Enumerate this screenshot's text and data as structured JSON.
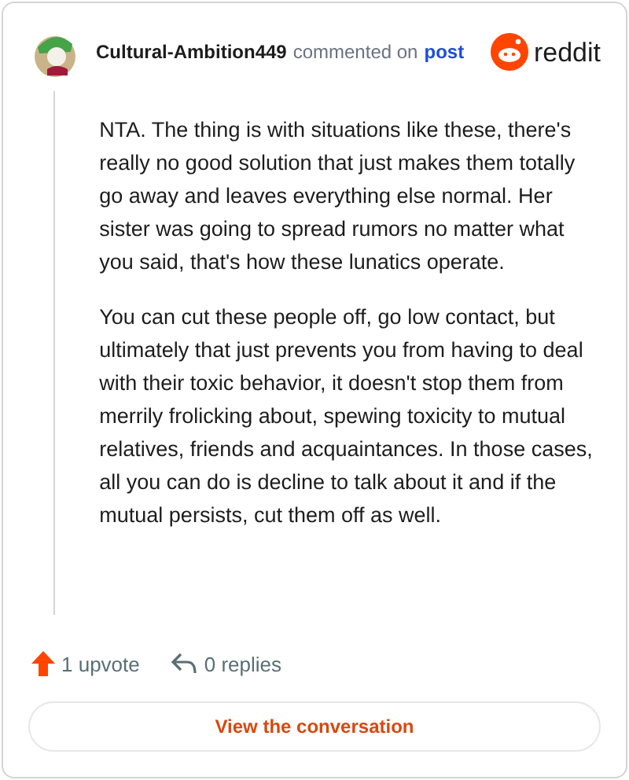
{
  "header": {
    "username": "Cultural-Ambition449",
    "action": "commented on",
    "link": "post",
    "brand": "reddit"
  },
  "comment": {
    "paragraphs": [
      "NTA. The thing is with situations like these, there's really no good solution that just makes them totally go away and leaves everything else normal. Her sister was going to spread rumors no matter what you said, that's how these lunatics operate.",
      "You can cut these people off, go low contact, but ultimately that just prevents you from having to deal with their toxic behavior, it doesn't stop them from merrily frolicking about, spewing toxicity to mutual relatives, friends and acquaintances. In those cases, all you can do is decline to talk about it and if the mutual persists, cut them off as well."
    ]
  },
  "stats": {
    "upvotes": "1 upvote",
    "replies": "0 replies"
  },
  "button": "View the conversation"
}
